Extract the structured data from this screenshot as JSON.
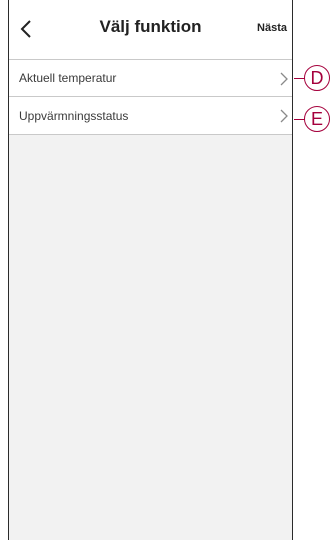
{
  "header": {
    "back_icon": "chevron-left-icon",
    "title": "Välj funktion",
    "next_label": "Nästa"
  },
  "functions": [
    {
      "label": "Aktuell temperatur",
      "icon": "chevron-right-icon",
      "callout": "D"
    },
    {
      "label": "Uppvärmningsstatus",
      "icon": "chevron-right-icon",
      "callout": "E"
    }
  ],
  "colors": {
    "callout": "#a5003c",
    "background": "#f2f2f2",
    "row_background": "#ffffff"
  }
}
